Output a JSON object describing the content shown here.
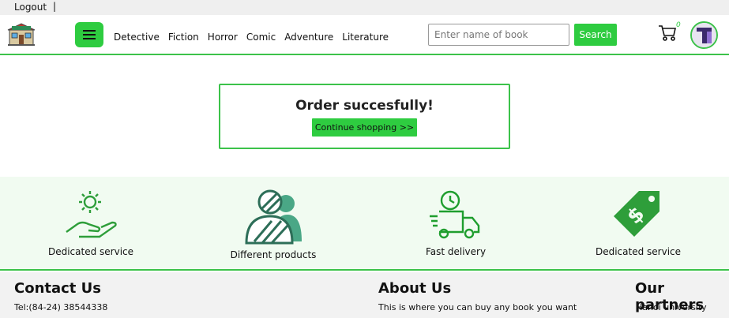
{
  "topbar": {
    "logout_label": "Logout",
    "separator": "|"
  },
  "header": {
    "nav": [
      "Detective",
      "Fiction",
      "Horror",
      "Comic",
      "Adventure",
      "Literature"
    ],
    "search": {
      "placeholder": "Enter name of book",
      "button_label": "Search"
    },
    "cart_count": "0"
  },
  "order": {
    "title": "Order succesfully!",
    "continue_label": "Continue shopping >>"
  },
  "services": [
    {
      "label": "Dedicated service",
      "icon": "hand-gear-icon"
    },
    {
      "label": "Different products",
      "icon": "users-icon"
    },
    {
      "label": "Fast delivery",
      "icon": "delivery-truck-icon"
    },
    {
      "label": "Dedicated service",
      "icon": "price-tag-icon"
    }
  ],
  "footer": {
    "contact": {
      "title": "Contact Us",
      "phone": "Tel:(84-24) 38544338"
    },
    "about": {
      "title": "About Us",
      "text": "This is where you can buy any book you want"
    },
    "partners": {
      "title": "Our partners",
      "first": "Hanoi university"
    }
  },
  "colors": {
    "accent": "#2ecc40",
    "service_bg": "#f1fbf1",
    "footer_bg": "#f2f2f2"
  }
}
